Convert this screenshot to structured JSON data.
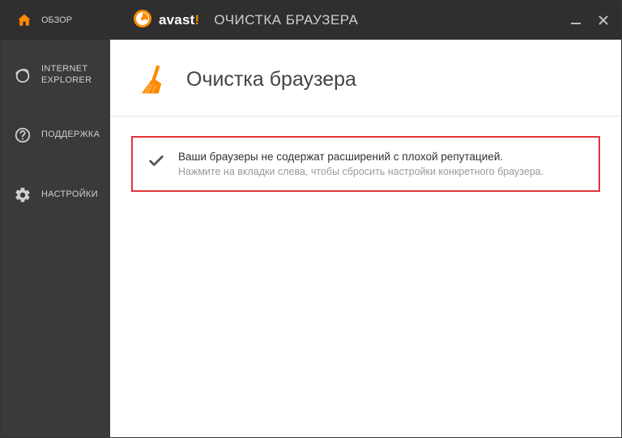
{
  "titlebar": {
    "brand": "avast",
    "bang": "!",
    "subtitle": "ОЧИСТКА БРАУЗЕРА"
  },
  "sidebar": {
    "items": [
      {
        "label": "ОБЗОР"
      },
      {
        "label": "INTERNET EXPLORER"
      },
      {
        "label": "ПОДДЕРЖКА"
      },
      {
        "label": "НАСТРОЙКИ"
      }
    ]
  },
  "page": {
    "title": "Очистка браузера",
    "status_heading": "Ваши браузеры не содержат расширений с плохой репутацией.",
    "status_sub": "Нажмите на вкладки слева, чтобы сбросить настройки конкретного браузера."
  },
  "colors": {
    "accent": "#ff8a00",
    "alert_border": "#e43535"
  }
}
